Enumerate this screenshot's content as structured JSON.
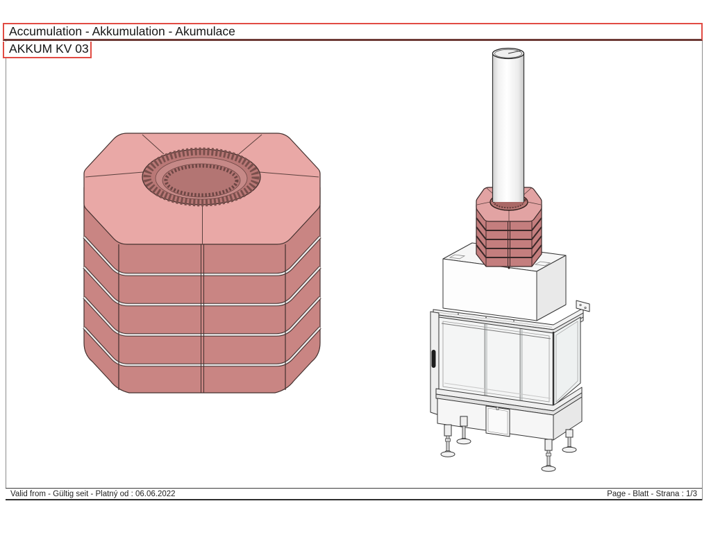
{
  "header": {
    "title": "Accumulation - Akkumulation - Akumulace",
    "model": "AKKUM KV 03"
  },
  "footer": {
    "valid_from": "Valid from - Gültig seit - Platný od : 06.06.2022",
    "page": "Page - Blatt - Strana : 1/3"
  },
  "colors": {
    "accent_red": "#e14b43",
    "accent_dark_red": "#6d3a36",
    "page_border_gray": "#8c8c8c",
    "footer_border": "#3a3a3a",
    "block_top_pink": "#e9a8a6",
    "block_side_pink": "#c98583",
    "block_hole_pink": "#b97876",
    "drawing_outline": "#43302e",
    "steel_light": "#f7f7f7",
    "steel_shade": "#e8e8e8"
  }
}
